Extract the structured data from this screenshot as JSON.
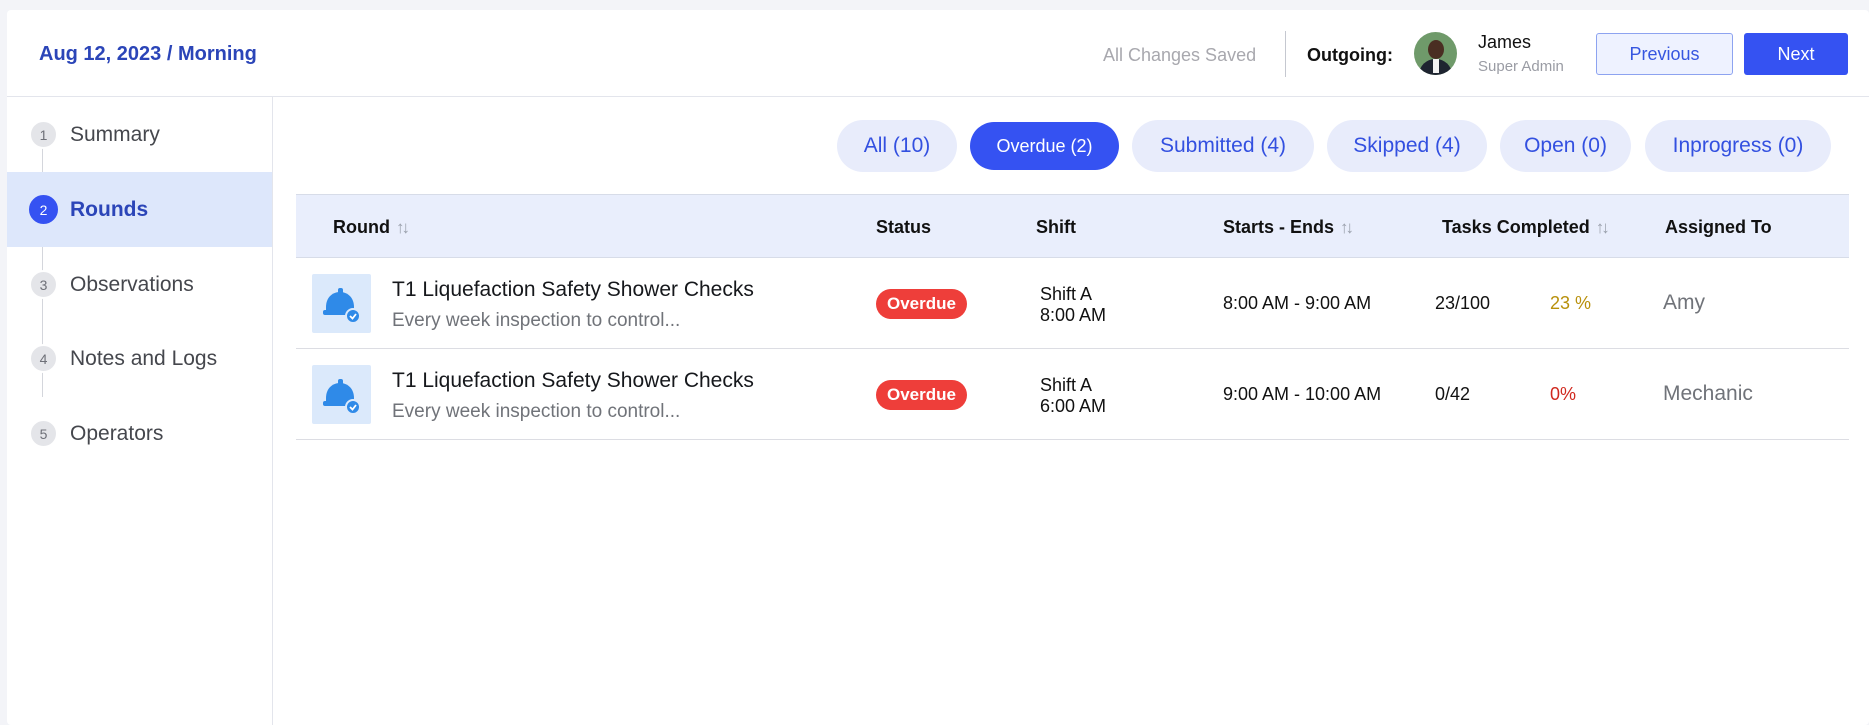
{
  "header": {
    "title": "Aug 12, 2023 / Morning",
    "save_status": "All Changes Saved",
    "outgoing_label": "Outgoing:",
    "user": {
      "name": "James",
      "role": "Super Admin"
    },
    "prev_label": "Previous",
    "next_label": "Next"
  },
  "sidebar": {
    "steps": [
      {
        "num": "1",
        "label": "Summary"
      },
      {
        "num": "2",
        "label": "Rounds"
      },
      {
        "num": "3",
        "label": "Observations"
      },
      {
        "num": "4",
        "label": "Notes and Logs"
      },
      {
        "num": "5",
        "label": "Operators"
      }
    ],
    "active_step": "Rounds"
  },
  "filters": [
    {
      "label": "All (10)"
    },
    {
      "label": "Overdue (2)"
    },
    {
      "label": "Submitted (4)"
    },
    {
      "label": "Skipped (4)"
    },
    {
      "label": "Open (0)"
    },
    {
      "label": "Inprogress (0)"
    }
  ],
  "active_filter": "Overdue (2)",
  "table": {
    "columns": [
      {
        "label": "Round",
        "sortable": true
      },
      {
        "label": "Status",
        "sortable": false
      },
      {
        "label": "Shift",
        "sortable": false
      },
      {
        "label": "Starts - Ends",
        "sortable": true
      },
      {
        "label": "Tasks Completed",
        "sortable": true
      },
      {
        "label": "Assigned To",
        "sortable": false
      }
    ],
    "rows": [
      {
        "icon": "hard-hat-icon",
        "title": "T1 Liquefaction Safety Shower Checks",
        "subtitle": "Every week inspection to control...",
        "status": "Overdue",
        "shift_name": "Shift A",
        "shift_time": "8:00 AM",
        "times": "8:00 AM - 9:00 AM",
        "tasks": "23/100",
        "percent": "23 %",
        "percent_color": "#b8900b",
        "assignee": "Amy"
      },
      {
        "icon": "hard-hat-icon",
        "title": "T1 Liquefaction Safety Shower Checks",
        "subtitle": "Every week inspection to control...",
        "status": "Overdue",
        "shift_name": "Shift A",
        "shift_time": "6:00 AM",
        "times": "9:00 AM - 10:00 AM",
        "tasks": "0/42",
        "percent": "0%",
        "percent_color": "#d0281e",
        "assignee": "Mechanic"
      }
    ]
  },
  "colors": {
    "primary": "#3552f2",
    "title_blue": "#2b45b8",
    "overdue_red": "#ee3e3a",
    "header_bg": "#e9eefc"
  }
}
